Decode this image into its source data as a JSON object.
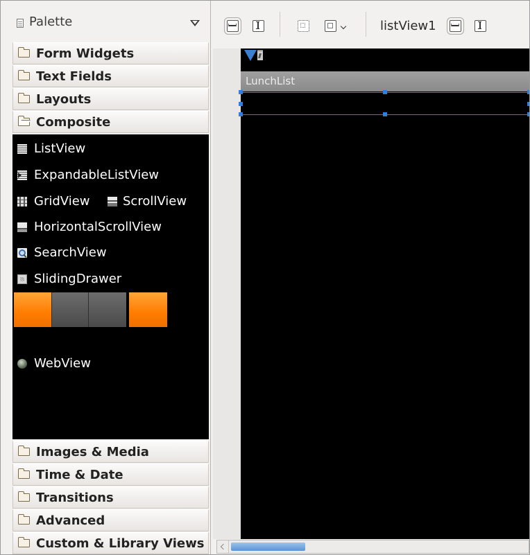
{
  "palette": {
    "title": "Palette",
    "categories_top": [
      {
        "label": "Form Widgets"
      },
      {
        "label": "Text Fields"
      },
      {
        "label": "Layouts"
      },
      {
        "label": "Composite",
        "expanded": true
      }
    ],
    "composite_items": [
      {
        "label": "ListView",
        "icon": "listview-icon"
      },
      {
        "label": "ExpandableListView",
        "icon": "expandable-listview-icon"
      },
      {
        "label": "GridView",
        "icon": "gridview-icon"
      },
      {
        "label": "ScrollView",
        "icon": "scrollview-icon"
      },
      {
        "label": "HorizontalScrollView",
        "icon": "horizontal-scrollview-icon"
      },
      {
        "label": "SearchView",
        "icon": "searchview-icon"
      },
      {
        "label": "SlidingDrawer",
        "icon": "slidingdrawer-icon"
      },
      {
        "label": "WebView",
        "icon": "webview-icon"
      }
    ],
    "categories_bottom": [
      {
        "label": "Images & Media"
      },
      {
        "label": "Time & Date"
      },
      {
        "label": "Transitions"
      },
      {
        "label": "Advanced"
      },
      {
        "label": "Custom & Library Views"
      }
    ]
  },
  "toolbar": {
    "selected_view": "listView1"
  },
  "device": {
    "app_title": "LunchList",
    "accent": "#2f7fe0",
    "tab_colors": [
      "#ff8a00",
      "#555555"
    ]
  }
}
